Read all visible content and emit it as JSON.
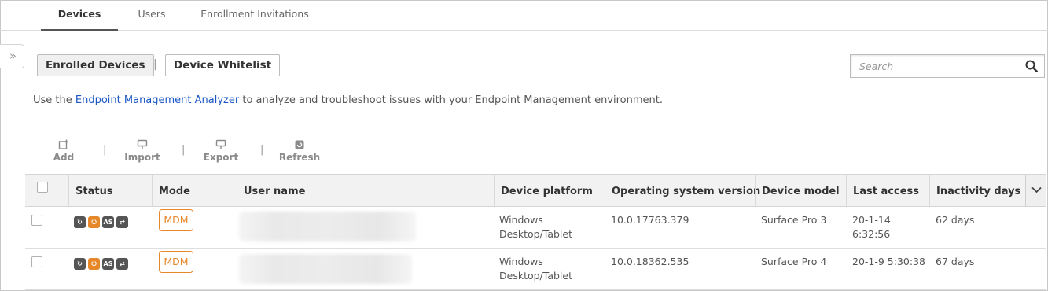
{
  "tabs": [
    {
      "label": "Devices",
      "active": true
    },
    {
      "label": "Users",
      "active": false
    },
    {
      "label": "Enrollment Invitations",
      "active": false
    }
  ],
  "subnav": {
    "enrolled": "Enrolled Devices",
    "separator": "|",
    "whitelist": "Device Whitelist"
  },
  "search": {
    "placeholder": "Search"
  },
  "info": {
    "prefix": "Use the ",
    "link": "Endpoint Management Analyzer",
    "suffix": " to analyze and troubleshoot issues with your Endpoint Management environment."
  },
  "toolbar": {
    "add": "Add",
    "import": "Import",
    "export": "Export",
    "refresh": "Refresh",
    "separator": "|"
  },
  "table": {
    "columns": [
      "Status",
      "Mode",
      "User name",
      "Device platform",
      "Operating system version",
      "Device model",
      "Last access",
      "Inactivity days"
    ],
    "rows": [
      {
        "mode": "MDM",
        "platform_line1": "Windows",
        "platform_line2": "Desktop/Tablet",
        "os_version": "10.0.17763.379",
        "model": "Surface Pro 3",
        "last_access_line1": "20-1-14",
        "last_access_line2": "6:32:56",
        "inactivity": "62 days"
      },
      {
        "mode": "MDM",
        "platform_line1": "Windows",
        "platform_line2": "Desktop/Tablet",
        "os_version": "10.0.18362.535",
        "model": "Surface Pro 4",
        "last_access_line1": "20-1-9 5:30:38",
        "last_access_line2": "",
        "inactivity": "67 days"
      }
    ],
    "status_icon_text": "AS"
  },
  "colors": {
    "accent_link": "#1a56c4",
    "mdm_orange": "#e6882a",
    "icon_gray": "#555555"
  }
}
